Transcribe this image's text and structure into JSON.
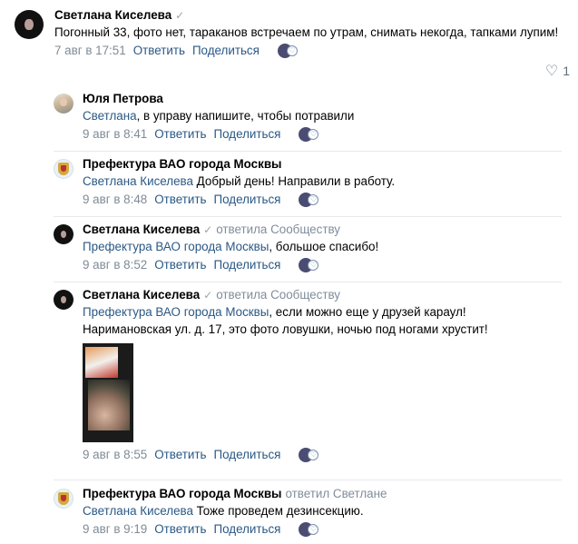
{
  "comments": [
    {
      "author": "Светлана Киселева",
      "text": "Погонный 33, фото нет, тараканов встречаем по утрам, снимать некогда, тапками лупим!",
      "date": "7 авг в 17:51",
      "reply_label": "Ответить",
      "share_label": "Поделиться",
      "like_count": "1"
    }
  ],
  "replies": [
    {
      "author": "Юля Петрова",
      "mention": "Светлана",
      "text": ", в управу напишите, чтобы потравили",
      "date": "9 авг в 8:41",
      "reply_label": "Ответить",
      "share_label": "Поделиться"
    },
    {
      "author": "Префектура ВАО города Москвы",
      "mention": "Светлана Киселева",
      "text": " Добрый день! Направили в работу.",
      "date": "9 авг в 8:48",
      "reply_label": "Ответить",
      "share_label": "Поделиться"
    },
    {
      "author": "Светлана Киселева",
      "context": "ответила Сообществу",
      "mention": "Префектура ВАО города Москвы",
      "text": ", большое спасибо!",
      "date": "9 авг в 8:52",
      "reply_label": "Ответить",
      "share_label": "Поделиться"
    },
    {
      "author": "Светлана Киселева",
      "context": "ответила Сообществу",
      "mention": "Префектура ВАО города Москвы",
      "text": ", если можно еще у друзей караул!",
      "text2": "Наримановская ул. д. 17, это фото ловушки, ночью под ногами хрустит!",
      "date": "9 авг в 8:55",
      "reply_label": "Ответить",
      "share_label": "Поделиться"
    },
    {
      "author": "Префектура ВАО города Москвы",
      "context": "ответил Светлане",
      "mention": "Светлана Киселева",
      "text": " Тоже проведем дезинсекцию.",
      "date": "9 авг в 9:19",
      "reply_label": "Ответить",
      "share_label": "Поделиться"
    }
  ],
  "icons": {
    "verified": "check-icon",
    "like": "heart-icon",
    "reactions": "reactions-icon"
  }
}
